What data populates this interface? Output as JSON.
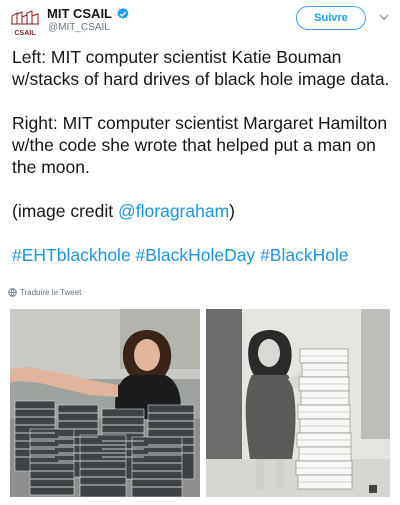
{
  "header": {
    "account_name": "MIT CSAIL",
    "handle": "@MIT_CSAIL",
    "follow_label": "Suivre",
    "avatar_logo_text": "CSAIL",
    "verified_icon": "verified-badge-icon",
    "menu_icon": "chevron-down-icon"
  },
  "tweet": {
    "paragraph1": "Left: MIT computer scientist Katie Bouman w/stacks of hard drives of black hole image data.",
    "paragraph2": "Right: MIT computer scientist Margaret Hamilton w/the code she wrote that helped put a man on the moon.",
    "credit_prefix": "(image credit ",
    "credit_mention": "@floragraham",
    "credit_suffix": ")",
    "hashtags": [
      "#EHTblackhole",
      "#BlackHoleDay",
      "#BlackHole"
    ]
  },
  "translate": {
    "label": "Traduire le Tweet",
    "icon": "globe-icon"
  },
  "media": {
    "left_photo": "photo-katie-bouman-hard-drives",
    "right_photo": "photo-margaret-hamilton-code"
  },
  "colors": {
    "link": "#1b95e0",
    "accent": "#1da1f2",
    "muted": "#657786",
    "text": "#14171a"
  }
}
